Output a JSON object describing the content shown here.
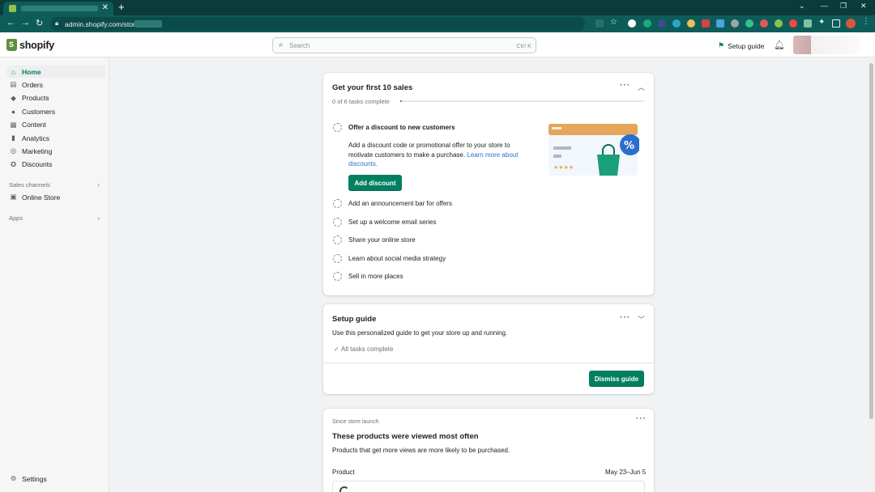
{
  "browser": {
    "tab_close": "✕",
    "new_tab": "+",
    "url": "admin.shopify.com/store",
    "window_controls": {
      "minimize": "⌄",
      "restore": "—",
      "maximize": "❐",
      "close": "✕"
    }
  },
  "topbar": {
    "logo_text": "shopify",
    "search_placeholder": "Search",
    "search_shortcut": "Ctrl K",
    "setup_guide_label": "Setup guide"
  },
  "sidebar": {
    "items": [
      {
        "label": "Home",
        "icon": "home-icon"
      },
      {
        "label": "Orders",
        "icon": "orders-icon"
      },
      {
        "label": "Products",
        "icon": "tag-icon"
      },
      {
        "label": "Customers",
        "icon": "person-icon"
      },
      {
        "label": "Content",
        "icon": "content-icon"
      },
      {
        "label": "Analytics",
        "icon": "bar-chart-icon"
      },
      {
        "label": "Marketing",
        "icon": "target-icon"
      },
      {
        "label": "Discounts",
        "icon": "discount-icon"
      }
    ],
    "sales_channels_heading": "Sales channels",
    "online_store_label": "Online Store",
    "apps_heading": "Apps",
    "settings_label": "Settings"
  },
  "first_sales_card": {
    "title": "Get your first 10 sales",
    "progress_text": "0 of 6 tasks complete",
    "progress": 0,
    "tasks": [
      "Offer a discount to new customers",
      "Add an announcement bar for offers",
      "Set up a welcome email series",
      "Share your online store",
      "Learn about social media strategy",
      "Sell in more places"
    ],
    "task_description": "Add a discount code or promotional offer to your store to motivate customers to make a purchase.",
    "task_link": "Learn more about discounts.",
    "button_label": "Add discount"
  },
  "setup_guide_card": {
    "title": "Setup guide",
    "subtitle": "Use this personalized guide to get your store up and running.",
    "status": "All tasks complete",
    "button_label": "Dismiss guide"
  },
  "products_card": {
    "eyebrow": "Since store launch",
    "title": "These products were viewed most often",
    "subtitle": "Products that get more views are more likely to be purchased.",
    "column_product": "Product",
    "date_range": "May 23–Jun 5"
  },
  "colors": {
    "accent": "#008060",
    "browser_frame": "#0e5c5a",
    "link": "#2c6ecb"
  }
}
